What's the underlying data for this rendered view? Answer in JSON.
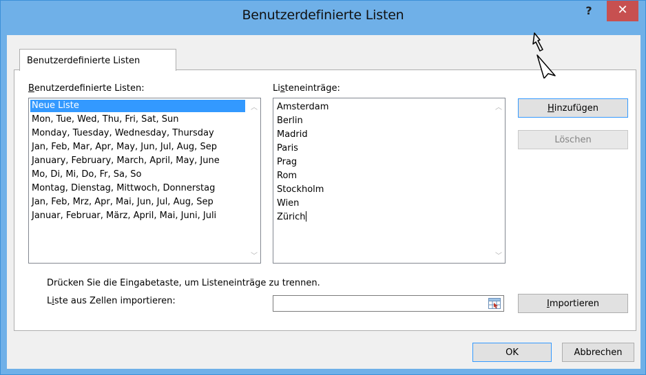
{
  "window": {
    "title": "Benutzerdefinierte Listen",
    "help_label": "?",
    "close_label": "✕"
  },
  "tab": {
    "label": "Benutzerdefinierte Listen"
  },
  "custom_lists": {
    "label_underlined": "B",
    "label_rest": "enutzerdefinierte Listen:",
    "items": [
      "Neue Liste",
      "Mon, Tue, Wed, Thu, Fri, Sat, Sun",
      "Monday, Tuesday, Wednesday, Thursday",
      "Jan, Feb, Mar, Apr, May, Jun, Jul, Aug, Sep",
      "January, February, March, April, May, June",
      "Mo, Di, Mi, Do, Fr, Sa, So",
      "Montag, Dienstag, Mittwoch, Donnerstag",
      "Jan, Feb, Mrz, Apr, Mai, Jun, Jul, Aug, Sep",
      "Januar, Februar, März, April, Mai, Juni, Juli"
    ],
    "selected_index": 0
  },
  "entries": {
    "label_pre": "Li",
    "label_underlined": "s",
    "label_rest": "teneinträge:",
    "items": [
      "Amsterdam",
      "Berlin",
      "Madrid",
      "Paris",
      "Prag",
      "Rom",
      "Stockholm",
      "Wien",
      "Zürich"
    ]
  },
  "buttons": {
    "add_underlined": "H",
    "add_rest": "inzufügen",
    "delete_label": "Löschen",
    "import_underlined": "I",
    "import_rest": "mportieren",
    "ok_label": "OK",
    "cancel_label": "Abbrechen"
  },
  "hint": {
    "text": "Drücken Sie die Eingabetaste, um Listeneinträge zu trennen."
  },
  "import": {
    "label_pre": "L",
    "label_underlined": "i",
    "label_rest": "ste aus Zellen importieren:",
    "value": ""
  },
  "colors": {
    "titlebar": "#6fb0e8",
    "close": "#c75050",
    "selection": "#3399ff"
  }
}
